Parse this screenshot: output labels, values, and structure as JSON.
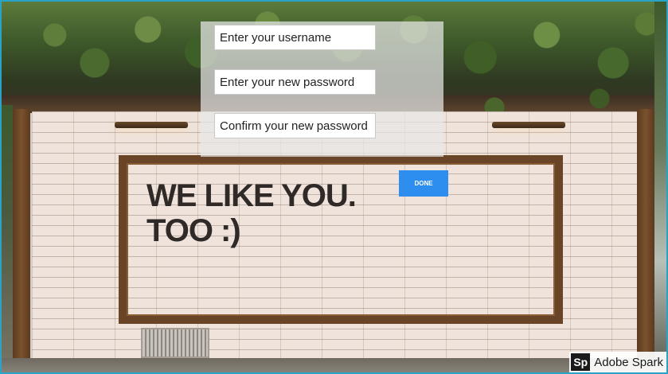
{
  "form": {
    "username_placeholder": "Enter your username",
    "new_password_placeholder": "Enter your new password",
    "confirm_password_placeholder": "Confirm your new password",
    "done_label": "DONE"
  },
  "background": {
    "wall_text_line1": "WE LIKE YOU.",
    "wall_text_line2": "TOO :)"
  },
  "watermark": {
    "logo": "Sp",
    "text": "Adobe Spark"
  },
  "colors": {
    "done_button": "#2e8ef0",
    "frame_border": "#2aa3c8"
  }
}
